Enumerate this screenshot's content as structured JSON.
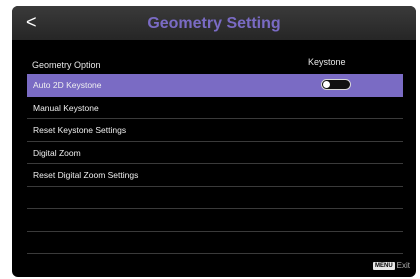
{
  "header": {
    "back_glyph": "<",
    "title": "Geometry Setting"
  },
  "columns": {
    "left": "Geometry Option",
    "right": "Keystone"
  },
  "menu": {
    "items": [
      {
        "label": "Auto 2D Keystone",
        "selected": true,
        "toggle": "off"
      },
      {
        "label": "Manual Keystone"
      },
      {
        "label": "Reset Keystone Settings"
      },
      {
        "label": "Digital Zoom"
      },
      {
        "label": "Reset Digital Zoom Settings"
      },
      {
        "label": ""
      },
      {
        "label": ""
      },
      {
        "label": ""
      }
    ]
  },
  "footer": {
    "key": "MENU",
    "action": "Exit"
  },
  "colors": {
    "accent": "#7a6bc4",
    "background": "#000000"
  },
  "icons": {
    "back": "chevron-left-icon",
    "toggle": "toggle-switch-icon"
  }
}
